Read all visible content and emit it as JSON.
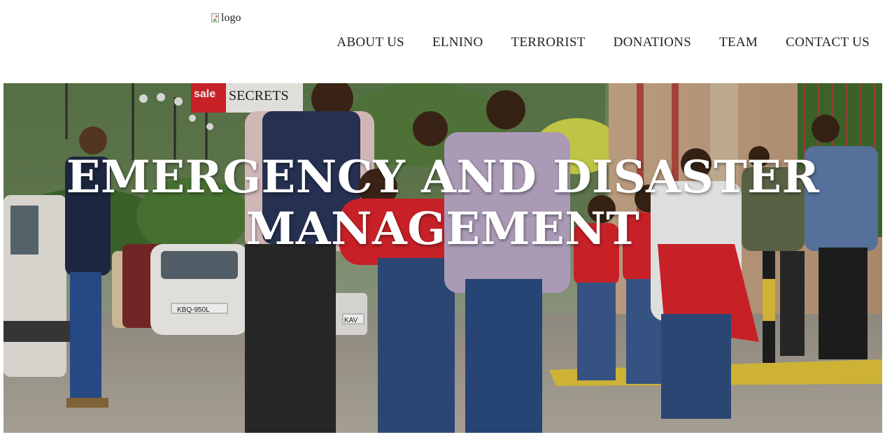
{
  "header": {
    "logo_alt": "logo",
    "nav": [
      {
        "label": "ABOUT US"
      },
      {
        "label": "ELNINO"
      },
      {
        "label": "TERRORIST"
      },
      {
        "label": "DONATIONS"
      },
      {
        "label": "TEAM"
      },
      {
        "label": "CONTACT US"
      }
    ]
  },
  "hero": {
    "title_line1": "EMERGENCY AND DISASTER",
    "title_line2": "MANAGEMENT",
    "photo_signs": {
      "store_sign_sale": "sale",
      "store_sign_name": "SECRETS",
      "plate_1": "KBQ-950L",
      "plate_2": "KAV"
    }
  },
  "colors": {
    "accent_red": "#d8242b",
    "title_text": "#ffffff"
  }
}
